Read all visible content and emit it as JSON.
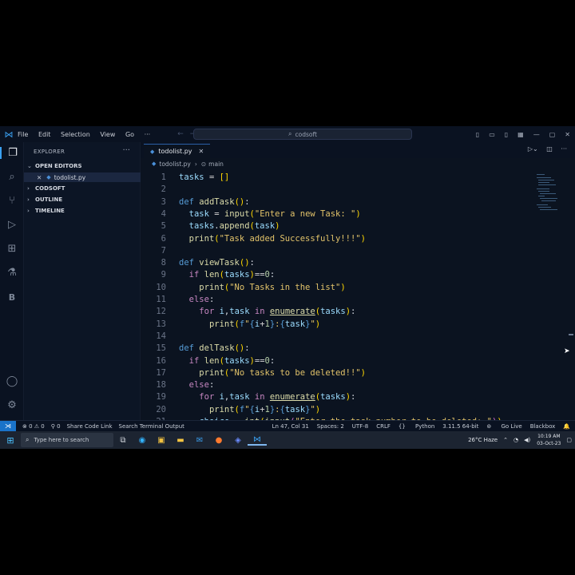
{
  "titlebar": {
    "menu": [
      "File",
      "Edit",
      "Selection",
      "View",
      "Go",
      "···"
    ],
    "search_text": "codsoft"
  },
  "sidebar": {
    "header": "EXPLORER",
    "sections": [
      {
        "label": "OPEN EDITORS",
        "expanded": true
      },
      {
        "label": "CODSOFT",
        "expanded": false
      },
      {
        "label": "OUTLINE",
        "expanded": false
      },
      {
        "label": "TIMELINE",
        "expanded": false
      }
    ],
    "open_file": "todolist.py"
  },
  "tabs": [
    {
      "label": "todolist.py",
      "active": true
    }
  ],
  "breadcrumb": {
    "file": "todolist.py",
    "symbol": "main"
  },
  "code": {
    "current_line": 0,
    "lines": [
      {
        "n": "1",
        "html": "<span class=\"va\">tasks</span> <span class=\"op\">=</span> <span class=\"br\">[]</span>"
      },
      {
        "n": "2",
        "html": ""
      },
      {
        "n": "3",
        "html": "<span class=\"kw\">def</span> <span class=\"fn\">addTask</span><span class=\"br\">()</span>:"
      },
      {
        "n": "4",
        "html": "  <span class=\"va\">task</span> <span class=\"op\">=</span> <span class=\"fn\">input</span><span class=\"br\">(</span><span class=\"st2\">\"Enter a new Task: \"</span><span class=\"br\">)</span>"
      },
      {
        "n": "5",
        "html": "  <span class=\"va\">tasks</span>.<span class=\"fn\">append</span><span class=\"br\">(</span><span class=\"va\">task</span><span class=\"br\">)</span>"
      },
      {
        "n": "6",
        "html": "  <span class=\"fn\">print</span><span class=\"br\">(</span><span class=\"st2\">\"Task added Successfully!!!\"</span><span class=\"br\">)</span>"
      },
      {
        "n": "7",
        "html": ""
      },
      {
        "n": "8",
        "html": "<span class=\"kw\">def</span> <span class=\"fn\">viewTask</span><span class=\"br\">()</span>:"
      },
      {
        "n": "9",
        "html": "  <span class=\"kw2\">if</span> <span class=\"fn\">len</span><span class=\"br\">(</span><span class=\"va\">tasks</span><span class=\"br\">)</span><span class=\"op\">==</span><span class=\"nu\">0</span>:"
      },
      {
        "n": "10",
        "html": "    <span class=\"fn\">print</span><span class=\"br\">(</span><span class=\"st2\">\"No Tasks in the list\"</span><span class=\"br\">)</span>"
      },
      {
        "n": "11",
        "html": "  <span class=\"kw2\">else</span>:"
      },
      {
        "n": "12",
        "html": "    <span class=\"kw2\">for</span> <span class=\"va\">i</span>,<span class=\"va\">task</span> <span class=\"kw2\">in</span> <span class=\"fn ul\">enumerate</span><span class=\"br\">(</span><span class=\"va\">tasks</span><span class=\"br\">)</span>:"
      },
      {
        "n": "13",
        "html": "      <span class=\"fn\">print</span><span class=\"br\">(</span><span class=\"kw\">f</span><span class=\"st2\">\"</span><span class=\"kw\">{</span><span class=\"va\">i</span><span class=\"op\">+</span><span class=\"nu\">1</span><span class=\"kw\">}</span><span class=\"st2\">:</span><span class=\"kw\">{</span><span class=\"va\">task</span><span class=\"kw\">}</span><span class=\"st2\">\"</span><span class=\"br\">)</span>"
      },
      {
        "n": "14",
        "html": ""
      },
      {
        "n": "15",
        "html": "<span class=\"kw\">def</span> <span class=\"fn\">delTask</span><span class=\"br\">()</span>:"
      },
      {
        "n": "16",
        "html": "  <span class=\"kw2\">if</span> <span class=\"fn\">len</span><span class=\"br\">(</span><span class=\"va\">tasks</span><span class=\"br\">)</span><span class=\"op\">==</span><span class=\"nu\">0</span>:"
      },
      {
        "n": "17",
        "html": "    <span class=\"fn\">print</span><span class=\"br\">(</span><span class=\"st2\">\"No tasks to be deleted!!\"</span><span class=\"br\">)</span>"
      },
      {
        "n": "18",
        "html": "  <span class=\"kw2\">else</span>:"
      },
      {
        "n": "19",
        "html": "    <span class=\"kw2\">for</span> <span class=\"va\">i</span>,<span class=\"va\">task</span> <span class=\"kw2\">in</span> <span class=\"fn ul\">enumerate</span><span class=\"br\">(</span><span class=\"va\">tasks</span><span class=\"br\">)</span>:"
      },
      {
        "n": "20",
        "html": "      <span class=\"fn\">print</span><span class=\"br\">(</span><span class=\"kw\">f</span><span class=\"st2\">\"</span><span class=\"kw\">{</span><span class=\"va\">i</span><span class=\"op\">+</span><span class=\"nu\">1</span><span class=\"kw\">}</span><span class=\"st2\">:</span><span class=\"kw\">{</span><span class=\"va\">task</span><span class=\"kw\">}</span><span class=\"st2\">\"</span><span class=\"br\">)</span>"
      },
      {
        "n": "21",
        "html": "    <span class=\"va\">choice</span> <span class=\"op\">=</span> <span class=\"fn\">int</span><span class=\"br\">(</span><span class=\"fn\">input</span><span class=\"br2\">(</span><span class=\"st2\">\"Enter the task number to be deleted: \"</span><span class=\"br2\">)</span><span class=\"br\">)</span>"
      }
    ]
  },
  "status": {
    "errors": "0",
    "warnings": "0",
    "ports": "0",
    "share": "Share Code Link",
    "terminal": "Search Terminal Output",
    "position": "Ln 47, Col 31",
    "spaces": "Spaces: 2",
    "encoding": "UTF-8",
    "eol": "CRLF",
    "language": "Python",
    "interpreter": "3.11.5 64-bit",
    "golive": "Go Live",
    "blackbox": "Blackbox"
  },
  "taskbar": {
    "search_placeholder": "Type here to search",
    "weather": "26°C Haze",
    "time": "10:19 AM",
    "date": "03-Oct-23"
  },
  "colors": {
    "accent": "#1a73c9",
    "editor_bg": "#0b1320"
  }
}
